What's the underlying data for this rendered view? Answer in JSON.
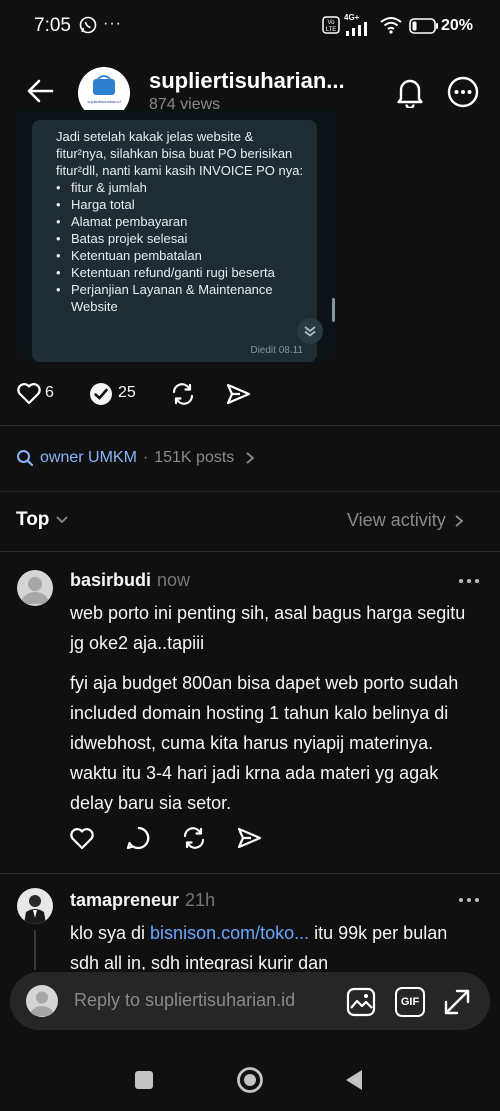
{
  "status_bar": {
    "time": "7:05",
    "dots": "···",
    "network_top": "4G+",
    "battery_percent": "20%"
  },
  "header": {
    "title": "supliertisuharian...",
    "views": "874 views",
    "logo_text": "supliertisuharian.id"
  },
  "post_image": {
    "intro": "Jadi setelah kakak jelas website & fitur²nya, silahkan bisa buat PO berisikan fitur²dll, nanti kami kasih INVOICE PO nya:",
    "items": [
      "fitur & jumlah",
      "Harga total",
      "Alamat pembayaran",
      "Batas projek selesai",
      "Ketentuan pembatalan",
      "Ketentuan refund/ganti rugi beserta",
      "Perjanjian Layanan & Maintenance Website"
    ],
    "edited": "Diedit 08.11"
  },
  "post_actions": {
    "likes": "6",
    "comments": "25"
  },
  "topic": {
    "tag": "owner UMKM",
    "separator": "·",
    "posts": "151K posts"
  },
  "sort": {
    "label": "Top",
    "view_activity": "View activity"
  },
  "comments": [
    {
      "username": "basirbudi",
      "time": "now",
      "paragraphs": [
        "web porto ini penting sih, asal bagus harga segitu jg oke2 aja..tapiii",
        "fyi aja budget 800an bisa dapet web porto sudah included domain hosting 1 tahun kalo belinya di idwebhost, cuma kita harus nyiapij materinya. waktu itu 3-4 hari jadi krna ada materi yg agak delay baru sia setor."
      ]
    },
    {
      "username": "tamapreneur",
      "time": "21h",
      "text_prefix": "klo sya di ",
      "link": "bisnison.com/toko...",
      "text_suffix": " itu 99k per bulan sdh all in, sdh integrasi kurir dan"
    }
  ],
  "reply_bar": {
    "placeholder": "Reply to supliertisuharian.id",
    "gif_label": "GIF"
  },
  "colors": {
    "background": "#101010",
    "link": "#69a7ff",
    "topic": "#8ab4f8",
    "muted": "#777777"
  }
}
